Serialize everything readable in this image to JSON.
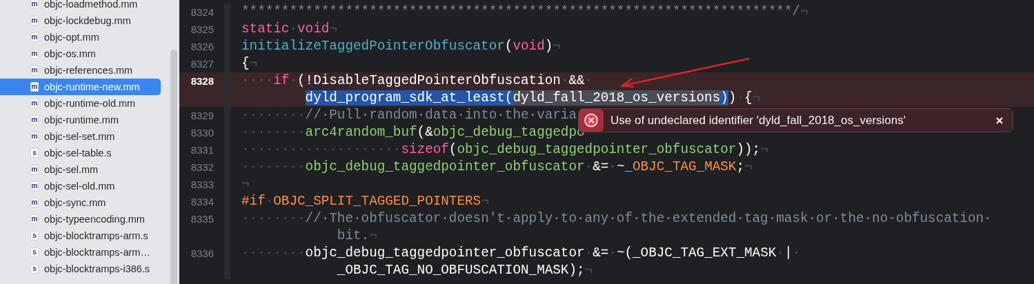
{
  "sidebar": {
    "files": [
      {
        "name": "objc-loadmethod.mm",
        "icon_letter": "m",
        "selected": false
      },
      {
        "name": "objc-lockdebug.mm",
        "icon_letter": "m",
        "selected": false
      },
      {
        "name": "objc-opt.mm",
        "icon_letter": "m",
        "selected": false
      },
      {
        "name": "objc-os.mm",
        "icon_letter": "m",
        "selected": false
      },
      {
        "name": "objc-references.mm",
        "icon_letter": "m",
        "selected": false
      },
      {
        "name": "objc-runtime-new.mm",
        "icon_letter": "m",
        "selected": true
      },
      {
        "name": "objc-runtime-old.mm",
        "icon_letter": "m",
        "selected": false
      },
      {
        "name": "objc-runtime.mm",
        "icon_letter": "m",
        "selected": false
      },
      {
        "name": "objc-sel-set.mm",
        "icon_letter": "m",
        "selected": false
      },
      {
        "name": "objc-sel-table.s",
        "icon_letter": "s",
        "selected": false
      },
      {
        "name": "objc-sel.mm",
        "icon_letter": "m",
        "selected": false
      },
      {
        "name": "objc-sel-old.mm",
        "icon_letter": "m",
        "selected": false
      },
      {
        "name": "objc-sync.mm",
        "icon_letter": "m",
        "selected": false
      },
      {
        "name": "objc-typeencoding.mm",
        "icon_letter": "m",
        "selected": false
      },
      {
        "name": "objc-blocktramps-arm.s",
        "icon_letter": "s",
        "selected": false
      },
      {
        "name": "objc-blocktramps-arm…",
        "icon_letter": "s",
        "selected": false
      },
      {
        "name": "objc-blocktramps-i386.s",
        "icon_letter": "s",
        "selected": false
      }
    ]
  },
  "editor": {
    "lines": [
      {
        "number": "8324",
        "error": false,
        "segments": [
          {
            "tokens": [
              {
                "text": "*********************************************************************/",
                "kind": "comment"
              },
              {
                "text": "¬",
                "kind": "ws"
              }
            ]
          }
        ]
      },
      {
        "number": "8325",
        "error": false,
        "segments": [
          {
            "tokens": [
              {
                "text": "static",
                "kind": "kw"
              },
              {
                "text": "·",
                "kind": "ws"
              },
              {
                "text": "void",
                "kind": "kw"
              },
              {
                "text": "¬",
                "kind": "ws"
              }
            ]
          }
        ]
      },
      {
        "number": "8326",
        "error": false,
        "segments": [
          {
            "tokens": [
              {
                "text": "initializeTaggedPointerObfuscator",
                "kind": "fn"
              },
              {
                "text": "(",
                "kind": "plain"
              },
              {
                "text": "void",
                "kind": "kw"
              },
              {
                "text": ")",
                "kind": "plain"
              },
              {
                "text": "¬",
                "kind": "ws"
              }
            ]
          }
        ]
      },
      {
        "number": "8327",
        "error": false,
        "segments": [
          {
            "tokens": [
              {
                "text": "{",
                "kind": "plain"
              },
              {
                "text": "¬",
                "kind": "ws"
              }
            ]
          }
        ]
      },
      {
        "number": "8328",
        "error": true,
        "segments": [
          {
            "tokens": [
              {
                "text": "····",
                "kind": "ws"
              },
              {
                "text": "if",
                "kind": "kw"
              },
              {
                "text": "·",
                "kind": "ws"
              },
              {
                "text": "(!DisableTaggedPointerObfuscation",
                "kind": "plain"
              },
              {
                "text": "·",
                "kind": "ws"
              },
              {
                "text": "&&",
                "kind": "plain"
              },
              {
                "text": "·",
                "kind": "ws"
              }
            ]
          },
          {
            "tokens": [
              {
                "text": "dyld_program_sdk_at_least(",
                "kind": "plain",
                "selected": true
              },
              {
                "text": "dyld_fall_2018_os_versions",
                "kind": "plain",
                "selected": true,
                "matched": true
              },
              {
                "text": ")",
                "kind": "plain",
                "selected": true
              },
              {
                "text": ")",
                "kind": "plain",
                "selected": false
              },
              {
                "text": "·",
                "kind": "ws",
                "selected": false
              },
              {
                "text": "{",
                "kind": "plain",
                "selected": false
              },
              {
                "text": "¬",
                "kind": "ws",
                "selected": false
              }
            ]
          }
        ]
      },
      {
        "number": "8329",
        "error": false,
        "segments": [
          {
            "tokens": [
              {
                "text": "········",
                "kind": "ws"
              },
              {
                "text": "//·Pull·random·data·into·the·varia",
                "kind": "comment"
              }
            ]
          }
        ]
      },
      {
        "number": "8330",
        "error": false,
        "segments": [
          {
            "tokens": [
              {
                "text": "········",
                "kind": "ws"
              },
              {
                "text": "arc4random_buf",
                "kind": "id"
              },
              {
                "text": "(&",
                "kind": "plain"
              },
              {
                "text": "objc_debug_taggedpo",
                "kind": "id"
              }
            ]
          }
        ]
      },
      {
        "number": "8331",
        "error": false,
        "segments": [
          {
            "tokens": [
              {
                "text": "····················",
                "kind": "ws"
              },
              {
                "text": "sizeof",
                "kind": "kw"
              },
              {
                "text": "(",
                "kind": "plain"
              },
              {
                "text": "objc_debug_taggedpointer_obfuscator",
                "kind": "id"
              },
              {
                "text": "));",
                "kind": "plain"
              },
              {
                "text": "¬",
                "kind": "ws"
              }
            ]
          }
        ]
      },
      {
        "number": "8332",
        "error": false,
        "segments": [
          {
            "tokens": [
              {
                "text": "········",
                "kind": "ws"
              },
              {
                "text": "objc_debug_taggedpointer_obfuscator",
                "kind": "id"
              },
              {
                "text": "·",
                "kind": "ws"
              },
              {
                "text": "&=",
                "kind": "plain"
              },
              {
                "text": "·",
                "kind": "ws"
              },
              {
                "text": "~",
                "kind": "plain"
              },
              {
                "text": "_OBJC_TAG_MASK",
                "kind": "macro"
              },
              {
                "text": ";",
                "kind": "plain"
              },
              {
                "text": "¬",
                "kind": "ws"
              }
            ]
          }
        ]
      },
      {
        "number": "8333",
        "error": false,
        "segments": [
          {
            "tokens": [
              {
                "text": "¬",
                "kind": "ws"
              }
            ]
          }
        ]
      },
      {
        "number": "8334",
        "error": false,
        "segments": [
          {
            "tokens": [
              {
                "text": "#if",
                "kind": "macro"
              },
              {
                "text": "·",
                "kind": "ws"
              },
              {
                "text": "OBJC_SPLIT_TAGGED_POINTERS",
                "kind": "macro"
              },
              {
                "text": "¬",
                "kind": "ws"
              }
            ]
          }
        ]
      },
      {
        "number": "8335",
        "error": false,
        "segments": [
          {
            "tokens": [
              {
                "text": "········",
                "kind": "ws"
              },
              {
                "text": "//·The·obfuscator·doesn't·apply·to·any·of·the·extended·tag·mask·or·the·no-obfuscation·",
                "kind": "comment"
              }
            ]
          },
          {
            "tokens": [
              {
                "text": "bit.",
                "kind": "comment"
              },
              {
                "text": "¬",
                "kind": "ws"
              }
            ]
          }
        ]
      },
      {
        "number": "8336",
        "error": false,
        "segments": [
          {
            "tokens": [
              {
                "text": "········",
                "kind": "ws"
              },
              {
                "text": "objc_debug_taggedpointer_obfuscator",
                "kind": "plain"
              },
              {
                "text": "·",
                "kind": "ws"
              },
              {
                "text": "&=",
                "kind": "plain"
              },
              {
                "text": "·",
                "kind": "ws"
              },
              {
                "text": "~(_OBJC_TAG_EXT_MASK",
                "kind": "plain"
              },
              {
                "text": "·",
                "kind": "ws"
              },
              {
                "text": "|",
                "kind": "plain"
              },
              {
                "text": "·",
                "kind": "ws"
              }
            ]
          },
          {
            "tokens": [
              {
                "text": "_OBJC_TAG_NO_OBFUSCATION_MASK);",
                "kind": "plain"
              },
              {
                "text": "¬",
                "kind": "ws"
              }
            ]
          }
        ]
      }
    ],
    "error_popup": {
      "message": "Use of undeclared identifier 'dyld_fall_2018_os_versions'"
    }
  }
}
